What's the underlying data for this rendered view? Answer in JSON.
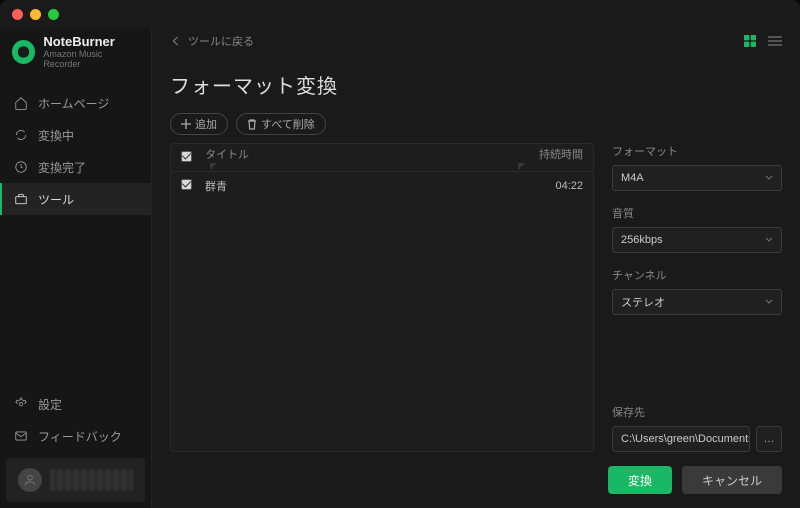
{
  "app": {
    "name": "NoteBurner",
    "subtitle": "Amazon Music Recorder"
  },
  "sidebar": {
    "items": [
      {
        "label": "ホームページ"
      },
      {
        "label": "変換中"
      },
      {
        "label": "変換完了"
      },
      {
        "label": "ツール"
      }
    ],
    "bottom": [
      {
        "label": "設定"
      },
      {
        "label": "フィードバック"
      }
    ]
  },
  "topbar": {
    "back": "ツールに戻る"
  },
  "page": {
    "title": "フォーマット変換"
  },
  "toolbar": {
    "add": "追加",
    "clear": "すべて削除"
  },
  "table": {
    "headers": {
      "title": "タイトル",
      "duration": "持続時間"
    },
    "rows": [
      {
        "title": "群青",
        "duration": "04:22"
      }
    ]
  },
  "panel": {
    "format": {
      "label": "フォーマット",
      "value": "M4A"
    },
    "quality": {
      "label": "音質",
      "value": "256kbps"
    },
    "channel": {
      "label": "チャンネル",
      "value": "ステレオ"
    },
    "dest": {
      "label": "保存先",
      "value": "C:\\Users\\green\\Documents"
    }
  },
  "footer": {
    "convert": "変換",
    "cancel": "キャンセル"
  }
}
